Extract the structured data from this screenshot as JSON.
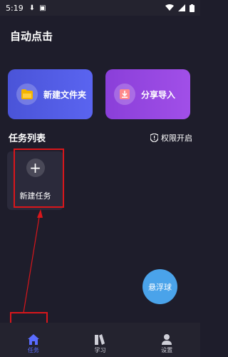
{
  "status_bar": {
    "time": "5:19"
  },
  "app": {
    "title": "自动点击"
  },
  "cards": [
    {
      "label": "新建文件夹",
      "icon": "folder-icon"
    },
    {
      "label": "分享导入",
      "icon": "import-icon"
    }
  ],
  "task_section": {
    "title": "任务列表",
    "permission_label": "权限开启"
  },
  "new_task": {
    "label": "新建任务",
    "plus": "+"
  },
  "float_ball": {
    "label": "悬浮球"
  },
  "tabs": [
    {
      "label": "任务",
      "icon": "home-icon",
      "active": true
    },
    {
      "label": "学习",
      "icon": "book-icon",
      "active": false
    },
    {
      "label": "设置",
      "icon": "user-icon",
      "active": false
    }
  ],
  "colors": {
    "background": "#1e1d2b",
    "card_blue": "#4a54d8",
    "card_purple": "#8a3fd9",
    "float_ball": "#4aa3ea",
    "active_tab": "#5a6cff",
    "annotation": "#d9161b"
  }
}
